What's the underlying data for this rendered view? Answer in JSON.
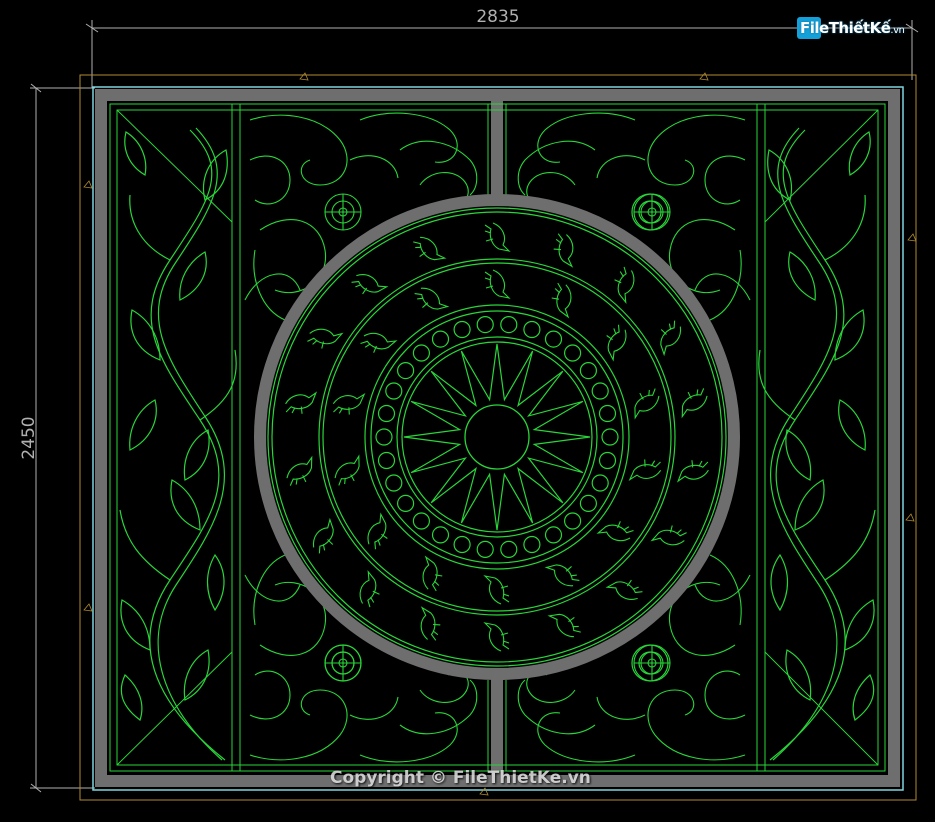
{
  "drawing": {
    "width_dimension": "2835",
    "height_dimension": "2450"
  },
  "watermark": {
    "brand_main": "File",
    "brand_accent": "ThiếtKế",
    "brand_domain": ".vn",
    "copyright": "Copyright © FileThietKe.vn"
  },
  "colors": {
    "background": "#000000",
    "line_green": "#29d639",
    "frame_gray": "#6e6e6e",
    "dimension_gray": "#b0b0b0",
    "outline_cyan": "#7fd6e0"
  },
  "icons": [
    "sun-motif-icon",
    "medallion-icon",
    "vine-ornament-icon",
    "bird-figure-icon"
  ]
}
